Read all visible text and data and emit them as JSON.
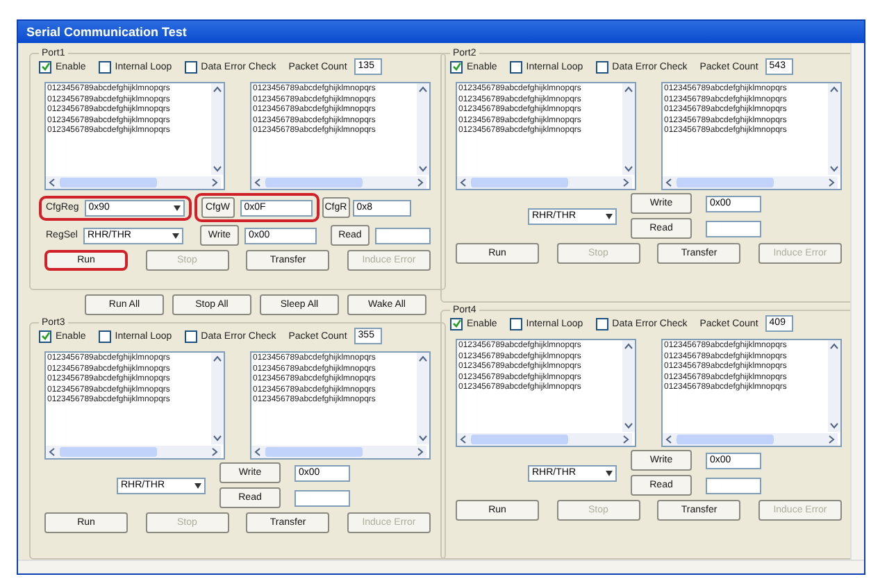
{
  "window": {
    "title": "Serial Communication Test"
  },
  "columns": [
    {
      "ports": [
        {
          "kind": "config",
          "title": "Port1",
          "options": [
            {
              "label": "Enable",
              "checked": true
            },
            {
              "label": "Internal Loop",
              "checked": false
            },
            {
              "label": "Data Error Check",
              "checked": false
            }
          ],
          "packet_count_label": "Packet Count",
          "packet_count": "135",
          "tx_lines": [
            "0123456789abcdefghijklmnopqrs",
            "0123456789abcdefghijklmnopqrs",
            "0123456789abcdefghijklmnopqrs",
            "0123456789abcdefghijklmnopqrs",
            "0123456789abcdefghijklmnopqrs"
          ],
          "rx_lines": [
            "0123456789abcdefghijklmnopqrs",
            "0123456789abcdefghijklmnopqrs",
            "0123456789abcdefghijklmnopqrs",
            "0123456789abcdefghijklmnopqrs",
            "0123456789abcdefghijklmnopqrs"
          ],
          "cfg_reg": {
            "label": "CfgReg",
            "value": "0x90",
            "highlighted": true
          },
          "cfg_write": {
            "button": "CfgW",
            "value": "0x0F",
            "highlighted": true
          },
          "cfg_read": {
            "button": "CfgR",
            "value": "0x8"
          },
          "reg_select": {
            "label": "RegSel",
            "value": "RHR/THR"
          },
          "write": {
            "button": "Write",
            "value": "0x00"
          },
          "read": {
            "button": "Read"
          },
          "buttons": [
            {
              "label": "Run",
              "disabled": false,
              "highlighted": true
            },
            {
              "label": "Stop",
              "disabled": true,
              "highlighted": false
            },
            {
              "label": "Transfer",
              "disabled": false,
              "highlighted": false
            },
            {
              "label": "Induce Error",
              "disabled": true,
              "highlighted": false
            }
          ]
        },
        {
          "kind": "global",
          "buttons": [
            {
              "label": "Run All"
            },
            {
              "label": "Stop All"
            },
            {
              "label": "Sleep All"
            },
            {
              "label": "Wake All"
            }
          ]
        },
        {
          "kind": "simple",
          "title": "Port3",
          "options": [
            {
              "label": "Enable",
              "checked": true
            },
            {
              "label": "Internal Loop",
              "checked": false
            },
            {
              "label": "Data Error Check",
              "checked": false
            }
          ],
          "packet_count_label": "Packet Count",
          "packet_count": "355",
          "tx_lines": [
            "0123456789abcdefghijklmnopqrs",
            "0123456789abcdefghijklmnopqrs",
            "0123456789abcdefghijklmnopqrs",
            "0123456789abcdefghijklmnopqrs",
            "0123456789abcdefghijklmnopqrs"
          ],
          "rx_lines": [
            "0123456789abcdefghijklmnopqrs",
            "0123456789abcdefghijklmnopqrs",
            "0123456789abcdefghijklmnopqrs",
            "0123456789abcdefghijklmnopqrs",
            "0123456789abcdefghijklmnopqrs"
          ],
          "reg_select": {
            "value": "RHR/THR"
          },
          "write": {
            "button": "Write",
            "value": "0x00"
          },
          "read": {
            "button": "Read"
          },
          "buttons": [
            {
              "label": "Run",
              "disabled": false,
              "highlighted": false
            },
            {
              "label": "Stop",
              "disabled": true,
              "highlighted": false
            },
            {
              "label": "Transfer",
              "disabled": false,
              "highlighted": false
            },
            {
              "label": "Induce Error",
              "disabled": true,
              "highlighted": false
            }
          ]
        }
      ]
    },
    {
      "ports": [
        {
          "kind": "simple",
          "title": "Port2",
          "options": [
            {
              "label": "Enable",
              "checked": true
            },
            {
              "label": "Internal Loop",
              "checked": false
            },
            {
              "label": "Data Error Check",
              "checked": false
            }
          ],
          "packet_count_label": "Packet Count",
          "packet_count": "543",
          "tx_lines": [
            "0123456789abcdefghijklmnopqrs",
            "0123456789abcdefghijklmnopqrs",
            "0123456789abcdefghijklmnopqrs",
            "0123456789abcdefghijklmnopqrs",
            "0123456789abcdefghijklmnopqrs"
          ],
          "rx_lines": [
            "0123456789abcdefghijklmnopqrs",
            "0123456789abcdefghijklmnopqrs",
            "0123456789abcdefghijklmnopqrs",
            "0123456789abcdefghijklmnopqrs",
            "0123456789abcdefghijklmnopqrs"
          ],
          "reg_select": {
            "value": "RHR/THR"
          },
          "write": {
            "button": "Write",
            "value": "0x00"
          },
          "read": {
            "button": "Read"
          },
          "buttons": [
            {
              "label": "Run",
              "disabled": false,
              "highlighted": false
            },
            {
              "label": "Stop",
              "disabled": true,
              "highlighted": false
            },
            {
              "label": "Transfer",
              "disabled": false,
              "highlighted": false
            },
            {
              "label": "Induce Error",
              "disabled": true,
              "highlighted": false
            }
          ]
        },
        {
          "kind": "simple",
          "title": "Port4",
          "options": [
            {
              "label": "Enable",
              "checked": true
            },
            {
              "label": "Internal Loop",
              "checked": false
            },
            {
              "label": "Data Error Check",
              "checked": false
            }
          ],
          "packet_count_label": "Packet Count",
          "packet_count": "409",
          "tx_lines": [
            "0123456789abcdefghijklmnopqrs",
            "0123456789abcdefghijklmnopqrs",
            "0123456789abcdefghijklmnopqrs",
            "0123456789abcdefghijklmnopqrs",
            "0123456789abcdefghijklmnopqrs"
          ],
          "rx_lines": [
            "0123456789abcdefghijklmnopqrs",
            "0123456789abcdefghijklmnopqrs",
            "0123456789abcdefghijklmnopqrs",
            "0123456789abcdefghijklmnopqrs",
            "0123456789abcdefghijklmnopqrs"
          ],
          "reg_select": {
            "value": "RHR/THR"
          },
          "write": {
            "button": "Write",
            "value": "0x00"
          },
          "read": {
            "button": "Read"
          },
          "buttons": [
            {
              "label": "Run",
              "disabled": false,
              "highlighted": false
            },
            {
              "label": "Stop",
              "disabled": true,
              "highlighted": false
            },
            {
              "label": "Transfer",
              "disabled": false,
              "highlighted": false
            },
            {
              "label": "Induce Error",
              "disabled": true,
              "highlighted": false
            }
          ]
        }
      ]
    }
  ]
}
